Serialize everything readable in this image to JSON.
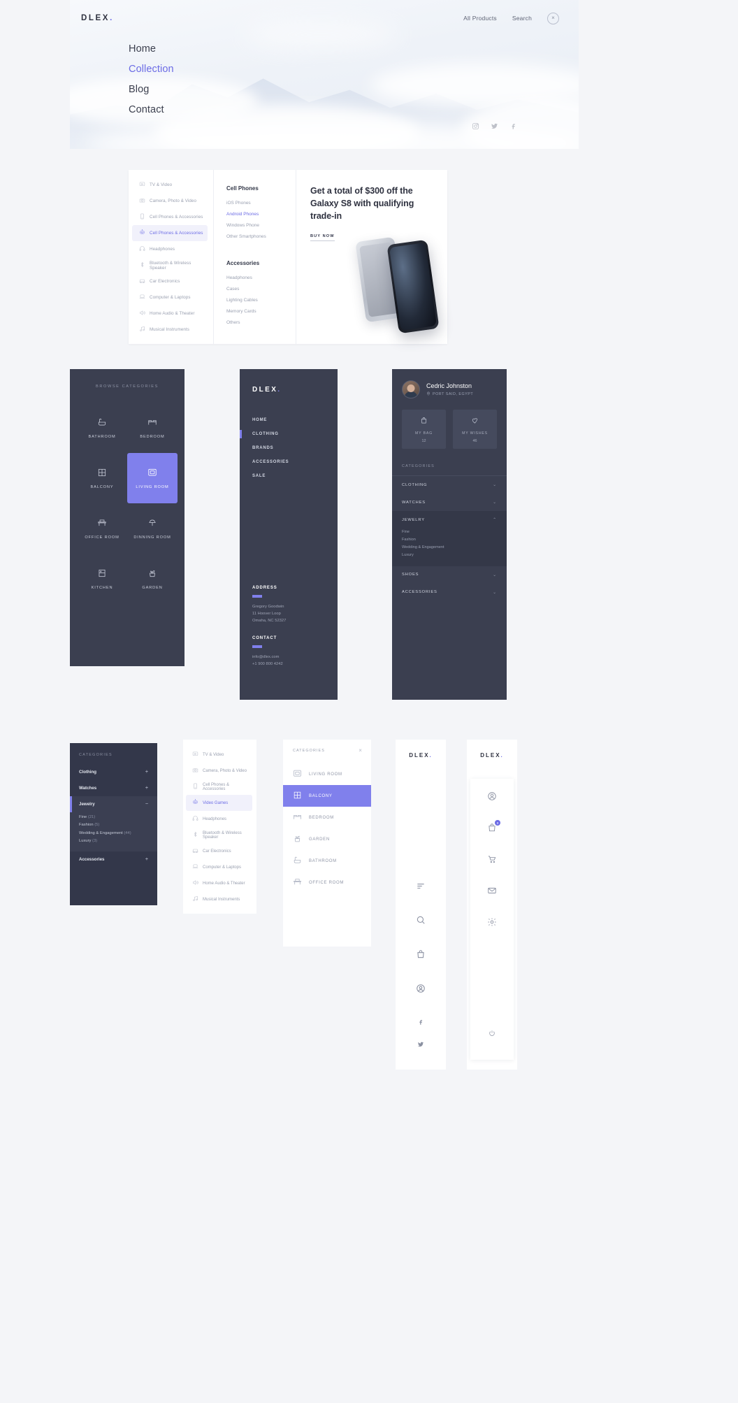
{
  "brand": {
    "name": "DLEX",
    "dot": "."
  },
  "hero": {
    "links": [
      {
        "label": "All Products",
        "name": "all-products-link"
      },
      {
        "label": "Search",
        "name": "search-link"
      }
    ],
    "close_icon": "×",
    "nav": [
      {
        "label": "Home",
        "active": false
      },
      {
        "label": "Collection",
        "active": true
      },
      {
        "label": "Blog",
        "active": false
      },
      {
        "label": "Contact",
        "active": false
      }
    ],
    "social": [
      "instagram-icon",
      "twitter-icon",
      "facebook-icon"
    ]
  },
  "mega_menu": {
    "categories": [
      {
        "label": "TV & Video",
        "icon": "tv-icon",
        "active": false
      },
      {
        "label": "Camera, Photo & Video",
        "icon": "camera-icon",
        "active": false
      },
      {
        "label": "Cell Phones & Accessories",
        "icon": "phone-icon",
        "active": false
      },
      {
        "label": "Cell Phones & Accessories",
        "icon": "robot-icon",
        "active": true
      },
      {
        "label": "Headphones",
        "icon": "headphones-icon",
        "active": false
      },
      {
        "label": "Bluetooth & Wireless Speaker",
        "icon": "bluetooth-icon",
        "active": false
      },
      {
        "label": "Car Electronics",
        "icon": "car-icon",
        "active": false
      },
      {
        "label": "Computer & Laptops",
        "icon": "laptop-icon",
        "active": false
      },
      {
        "label": "Home Audio & Theater",
        "icon": "speaker-icon",
        "active": false
      },
      {
        "label": "Musical Instruments",
        "icon": "music-icon",
        "active": false
      }
    ],
    "group_one": {
      "title": "Cell Phones",
      "items": [
        {
          "label": "iOS Phones",
          "active": false
        },
        {
          "label": "Android Phones",
          "active": true
        },
        {
          "label": "Windows Phone",
          "active": false
        },
        {
          "label": "Other Smartphones",
          "active": false
        }
      ]
    },
    "group_two": {
      "title": "Accessories",
      "items": [
        {
          "label": "Headphones",
          "active": false
        },
        {
          "label": "Cases",
          "active": false
        },
        {
          "label": "Lighting Cables",
          "active": false
        },
        {
          "label": "Memory Cards",
          "active": false
        },
        {
          "label": "Others",
          "active": false
        }
      ]
    },
    "promo": {
      "headline": "Get a total of $300 off the Galaxy S8 with qualifying trade-in",
      "cta": "BUY NOW"
    }
  },
  "browse_card": {
    "heading": "BROWSE CATEGORIES",
    "items": [
      {
        "label": "BATHROOM",
        "icon": "bathtub-icon",
        "active": false
      },
      {
        "label": "BEDROOM",
        "icon": "bed-icon",
        "active": false
      },
      {
        "label": "BALCONY",
        "icon": "balcony-icon",
        "active": false
      },
      {
        "label": "LIVING ROOM",
        "icon": "sofa-icon",
        "active": true
      },
      {
        "label": "OFFICE ROOM",
        "icon": "desk-icon",
        "active": false
      },
      {
        "label": "DINNING ROOM",
        "icon": "dining-icon",
        "active": false
      },
      {
        "label": "KITCHEN",
        "icon": "kitchen-icon",
        "active": false
      },
      {
        "label": "GARDEN",
        "icon": "plant-icon",
        "active": false
      }
    ]
  },
  "nav_card": {
    "items": [
      {
        "label": "HOME",
        "active": false
      },
      {
        "label": "CLOTHING",
        "active": true
      },
      {
        "label": "BRANDS",
        "active": false
      },
      {
        "label": "ACCESSORIES",
        "active": false
      },
      {
        "label": "SALE",
        "active": false
      }
    ],
    "address": {
      "title": "ADDRESS",
      "lines": [
        "Gregory Goodwin",
        "11 Hoover Loop",
        "Omaha, NC 52327"
      ]
    },
    "contact": {
      "title": "CONTACT",
      "lines": [
        "info@dlex.com",
        "+1 900 800 4242"
      ]
    }
  },
  "profile_card": {
    "name": "Cedric Johnston",
    "location": "PORT SAID, EGYPT",
    "location_icon": "pin-icon",
    "stats": [
      {
        "label": "MY BAG",
        "value": "12",
        "icon": "bag-icon"
      },
      {
        "label": "MY WISHES",
        "value": "46",
        "icon": "heart-icon"
      }
    ],
    "categories_heading": "CATEGORIES",
    "accordion": [
      {
        "label": "CLOTHING",
        "open": false,
        "chevron": "⌄",
        "items": []
      },
      {
        "label": "WATCHES",
        "open": false,
        "chevron": "⌄",
        "items": []
      },
      {
        "label": "JEWELRY",
        "open": true,
        "chevron": "⌃",
        "items": [
          "Fine",
          "Fashion",
          "Wedding & Engagement",
          "Luxury"
        ]
      },
      {
        "label": "SHOES",
        "open": false,
        "chevron": "⌄",
        "items": []
      },
      {
        "label": "ACCESSORIES",
        "open": false,
        "chevron": "⌄",
        "items": []
      }
    ]
  },
  "cat_dark": {
    "heading": "CATEGORIES",
    "rows": [
      {
        "label": "Clothing",
        "sign": "+",
        "open": false,
        "items": []
      },
      {
        "label": "Watches",
        "sign": "+",
        "open": false,
        "items": []
      },
      {
        "label": "Jewelry",
        "sign": "−",
        "open": true,
        "items": [
          {
            "label": "Fine",
            "count": "(21)"
          },
          {
            "label": "Fashion",
            "count": "(5)"
          },
          {
            "label": "Wedding & Engagement",
            "count": "(44)"
          },
          {
            "label": "Luxury",
            "count": "(3)"
          }
        ]
      },
      {
        "label": "Accessories",
        "sign": "+",
        "open": false,
        "items": []
      }
    ]
  },
  "white_list": {
    "items": [
      {
        "label": "TV & Video",
        "icon": "tv-icon",
        "active": false
      },
      {
        "label": "Camera, Photo & Video",
        "icon": "camera-icon",
        "active": false
      },
      {
        "label": "Cell Phones & Accessories",
        "icon": "phone-icon",
        "active": false
      },
      {
        "label": "Video Games",
        "icon": "robot-icon",
        "active": true
      },
      {
        "label": "Headphones",
        "icon": "headphones-icon",
        "active": false
      },
      {
        "label": "Bluetooth & Wireless Speaker",
        "icon": "bluetooth-icon",
        "active": false
      },
      {
        "label": "Car Electronics",
        "icon": "car-icon",
        "active": false
      },
      {
        "label": "Computer & Laptops",
        "icon": "laptop-icon",
        "active": false
      },
      {
        "label": "Home Audio & Theater",
        "icon": "speaker-icon",
        "active": false
      },
      {
        "label": "Musical Instruments",
        "icon": "music-icon",
        "active": false
      }
    ]
  },
  "room_card": {
    "heading": "CATEGORIES",
    "close_icon": "×",
    "items": [
      {
        "label": "LIVING ROOM",
        "icon": "sofa-icon",
        "active": false
      },
      {
        "label": "BALCONY",
        "icon": "balcony-icon",
        "active": true
      },
      {
        "label": "BEDROOM",
        "icon": "bed-icon",
        "active": false
      },
      {
        "label": "GARDEN",
        "icon": "plant-icon",
        "active": false
      },
      {
        "label": "BATHROOM",
        "icon": "bathtub-icon",
        "active": false
      },
      {
        "label": "OFFICE ROOM",
        "icon": "desk-icon",
        "active": false
      }
    ]
  },
  "rail_a": {
    "icons": [
      "menu-icon",
      "search-icon",
      "bag-icon",
      "user-icon"
    ],
    "bottom": [
      "facebook-icon",
      "twitter-icon"
    ]
  },
  "rail_b": {
    "icons": [
      "user-icon",
      "bag-icon",
      "cart-icon",
      "mail-icon",
      "gear-icon"
    ],
    "badge": "0",
    "bottom": [
      "power-icon"
    ]
  },
  "colors": {
    "accent": "#6c6ce5",
    "accent_light": "#8080ec",
    "dark": "#3b3f50",
    "dark_deep": "#33374a",
    "page_bg": "#f4f5f8"
  }
}
